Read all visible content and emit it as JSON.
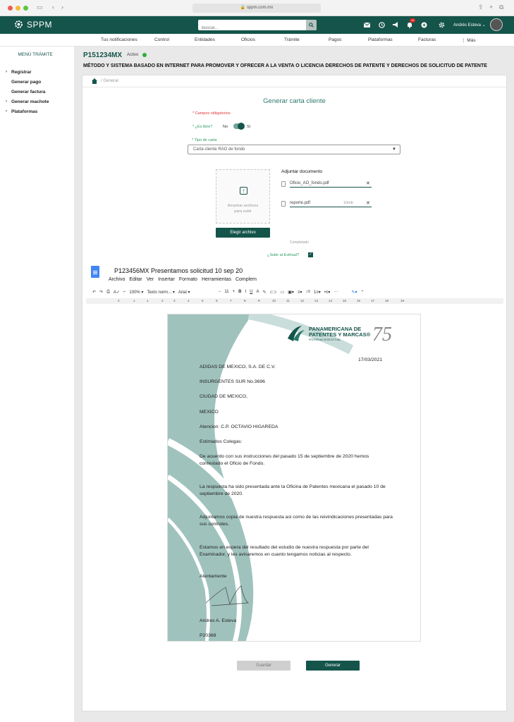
{
  "browser": {
    "url": "sppm.com.mx"
  },
  "app": {
    "name": "SPPM",
    "search_placeholder": "Buscar...",
    "user_name": "Andrés Esteva",
    "notification_count": "10"
  },
  "nav": [
    "Tus notificaciones",
    "Control",
    "Entidades",
    "Oficios",
    "Trámite",
    "Pagos",
    "Plataformas",
    "Facturas",
    "⋮ Más"
  ],
  "sidebar": {
    "title": "MENÚ TRÁMITE",
    "items": [
      {
        "label": "Registrar",
        "expandable": true
      },
      {
        "label": "Generar pago",
        "expandable": false
      },
      {
        "label": "Generar factura",
        "expandable": false
      },
      {
        "label": "Generar machote",
        "expandable": true
      },
      {
        "label": "Plataformas",
        "expandable": true
      }
    ]
  },
  "header": {
    "id": "P151234MX",
    "status": "Activo",
    "status_color": "#2fae3c",
    "title": "MÉTODO Y SISTEMA BASADO EN INTERNET PARA PROMOVER Y OFRECER A LA VENTA O LICENCIA DERECHOS DE PATENTE Y DERECHOS DE SOLICITUD DE PATENTE"
  },
  "breadcrumb": {
    "current": "Generar"
  },
  "form": {
    "title": "Generar carta cliente",
    "required_note": "* Campos obligatorios",
    "free_label": "* ¿Es libre?",
    "toggle_off": "No",
    "toggle_on": "Sí",
    "toggle_value": "Sí",
    "type_label": "* Tipo de carta",
    "type_value": "Carta cliente RAO de fondo",
    "drop_text_1": "Arrastrar archivos",
    "drop_text_2": "para subir",
    "choose_button": "Elegir archivo",
    "attach_title": "Adjuntar documento",
    "files": [
      {
        "name": "Oficio_AO_fondo.pdf",
        "size": "",
        "status": ""
      },
      {
        "name": "reporte.pdf",
        "size": "10mb",
        "status": "Completado"
      }
    ],
    "evirtual_label": "¿Subir al Evirtual?",
    "evirtual_checked": true,
    "save_button": "Guardar",
    "generate_button": "Generar"
  },
  "doc": {
    "title": "P123456MX Presentamos solicitud 10 sep 20",
    "menu": [
      "Archivo",
      "Editar",
      "Ver",
      "Insertar",
      "Formato",
      "Herramientas",
      "Complem"
    ],
    "zoom": "100%",
    "style": "Texto norm...",
    "font": "Arial",
    "font_size": "11",
    "ruler": [
      "2",
      "1",
      "1",
      "2",
      "3",
      "4",
      "5",
      "6",
      "7",
      "8",
      "9",
      "10",
      "11",
      "12",
      "13",
      "14",
      "15",
      "16",
      "17",
      "18",
      "19"
    ]
  },
  "letter": {
    "brand_line1": "PANAMERICANA DE",
    "brand_line2": "PATENTES Y MARCAS®",
    "brand_sub": "PROPIEDAD INTELECTUAL",
    "anniversary": "75",
    "date": "17/03/2021",
    "addressee": "ADIDAS DE MEXICO, S.A. DE C.V.",
    "street": "INSURGENTES SUR No.3696",
    "city": "CIUDAD DE MEXICO,",
    "country": "MEXICO",
    "attention": "Atencion: C.P. OCTAVIO HIGAREDA",
    "greeting": "Estimados Colegas:",
    "p1": "De acuerdo con sus instrucciones del pasado 15 de septiembre de 2020 hemos contestado el Oficio de Fondo.",
    "p2": "La respuesta ha sido presentada ante la Oficina de Patentes mexicana el pasado 10 de septiembre de 2020.",
    "p3": "Adjuntamos copia de nuestra respuesta asi como de las reivindicaciones presentadas para sus controles.",
    "p4": "Estamos en espera del resultado del estudio de nuestra respuesta por parte del Examinador, y les avisaremos en cuanto tengamos noticias al respecto.",
    "closing": "Atentamente",
    "signer": "Andres A. Esteva",
    "ref": "P20368"
  },
  "colors": {
    "primary": "#14544a",
    "accent": "#2a9a60",
    "required": "#e03838",
    "letter_wave": "#9fc2bd"
  }
}
